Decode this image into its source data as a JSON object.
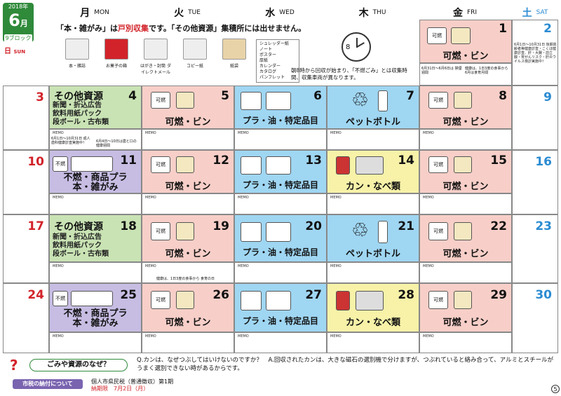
{
  "header": {
    "year": "2018年",
    "month": "6",
    "month_suffix": "月",
    "block": "9ブロック",
    "days": [
      {
        "k": "月",
        "e": "MON"
      },
      {
        "k": "火",
        "e": "TUE"
      },
      {
        "k": "水",
        "e": "WED"
      },
      {
        "k": "木",
        "e": "THU"
      },
      {
        "k": "金",
        "e": "FRI"
      },
      {
        "k": "土",
        "e": "SAT"
      }
    ],
    "sun_k": "日",
    "sun_e": "SUN"
  },
  "notice": {
    "a": "「本・雑がみ」は",
    "b": "戸別収集",
    "c": "です。「その他資源」集積所には出せません。"
  },
  "items": [
    "本・雑誌",
    "お菓子の箱",
    "はがき・封筒 ダイレクトメール",
    "コピー紙",
    "紙袋"
  ],
  "paper_types": [
    "シュレッダー紙",
    "ノート",
    "ポスター",
    "厚紙",
    "カレンダー",
    "カタログ",
    "パンフレット"
  ],
  "clock_num": "8",
  "collect_time": "朝8時から回収が始まり、「不燃ごみ」とは収集時間、収集車両が異なります。",
  "memo": "MEMO",
  "labels": {
    "kanen": "可燃・ビン",
    "pura": "プラ・油・特定品目",
    "pet": "ペットボトル",
    "kan": "カン・なべ類",
    "sonota": "その他資源",
    "funen1": "不燃・商品プラ",
    "funen2": "本・雑がみ",
    "kanen_icon": "可燃",
    "funen_icon": "不燃"
  },
  "sonota_sub": [
    "新聞・折込広告",
    "飲料用紙パック",
    "段ボール・古布類"
  ],
  "days_row": [
    [
      "1",
      "2"
    ],
    [
      "3",
      "4",
      "5",
      "6",
      "7",
      "8",
      "9"
    ],
    [
      "10",
      "11",
      "12",
      "13",
      "14",
      "15",
      "16"
    ],
    [
      "17",
      "18",
      "19",
      "20",
      "21",
      "22",
      "23"
    ],
    [
      "24",
      "25",
      "26",
      "27",
      "28",
      "29",
      "30"
    ]
  ],
  "notes": {
    "sat2": "6月1日～10月31日 後期高齢者等健康診査・こくほ健康診査、肝・大腸・前立腺・胃がんリスク・肝炎ウイルス検診実施中！",
    "fri1a": "6月31日～6月6日は 禁煙週間",
    "fri1b": "健康は、1日3度の食事から 6月は食育月間",
    "mon4a": "6月1日～10月31日 成人歯科健康診査実施中！",
    "mon4b": "6月4日～10日は歯と口の健康週間",
    "tue19": "健康は、1日3度の食事から 食育の日"
  },
  "qa": {
    "title": "ごみや資源のなぜ？",
    "mark": "?",
    "text": "Q.カンは、なぜつぶしてはいけないのですか？　A.回収されたカンは、大きな磁石の選別機で分けますが、つぶれていると絡み合って、アルミとスチールがうまく選別できない時があるからです。"
  },
  "tax": {
    "btn": "市税の納付について",
    "l1": "個人市県民税（普通徴収）第1期",
    "l2a": "納期限",
    "l2b": "7月2日（月）"
  },
  "page": "5",
  "colors": {
    "green": "#2f8a3a",
    "red": "#d2232a",
    "blue": "#2a8bd2",
    "pink": "#f7cfc8",
    "lightblue": "#9fd6f2",
    "yellow": "#f7f2a8",
    "lightgreen": "#c9e3b4",
    "purple": "#c7bde3"
  }
}
